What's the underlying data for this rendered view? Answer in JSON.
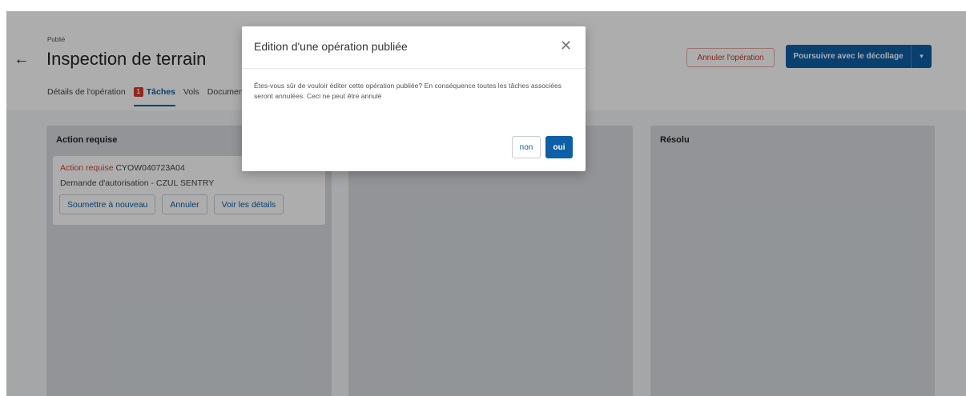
{
  "header": {
    "status": "Publié",
    "title": "Inspection de terrain",
    "back_icon": "arrow-left-icon",
    "tabs": [
      {
        "label": "Détails de l'opération"
      },
      {
        "label": "Tâches",
        "badge": "1"
      },
      {
        "label": "Vols"
      },
      {
        "label": "Documents"
      }
    ],
    "cancel_operation_label": "Annuler l'opération",
    "proceed_label": "Poursuivre avec le décollage",
    "caret_icon": "chevron-down-icon"
  },
  "board": {
    "columns": [
      {
        "title": "Action requise"
      },
      {
        "title": ""
      },
      {
        "title": "Résolu"
      }
    ],
    "card": {
      "status": "Action requise",
      "code": "CYOW040723A04",
      "description": "Demande d'autorisation - CZUL SENTRY",
      "buttons": [
        "Soumettre à nouveau",
        "Annuler",
        "Voir les détails"
      ]
    }
  },
  "modal": {
    "title": "Edition d'une opération publiée",
    "close_icon": "close-icon",
    "body": "Êtes-vous sûr de vouloir éditer cette opération publiée? En conséquence toutes les tâches associées seront annulées. Ceci ne peut être annulé",
    "no_label": "non",
    "yes_label": "oui"
  },
  "colors": {
    "primary": "#0d5fa6",
    "danger": "#c73628",
    "badge": "#d93a2c",
    "overlay": "rgba(0,0,0,0.32)"
  }
}
